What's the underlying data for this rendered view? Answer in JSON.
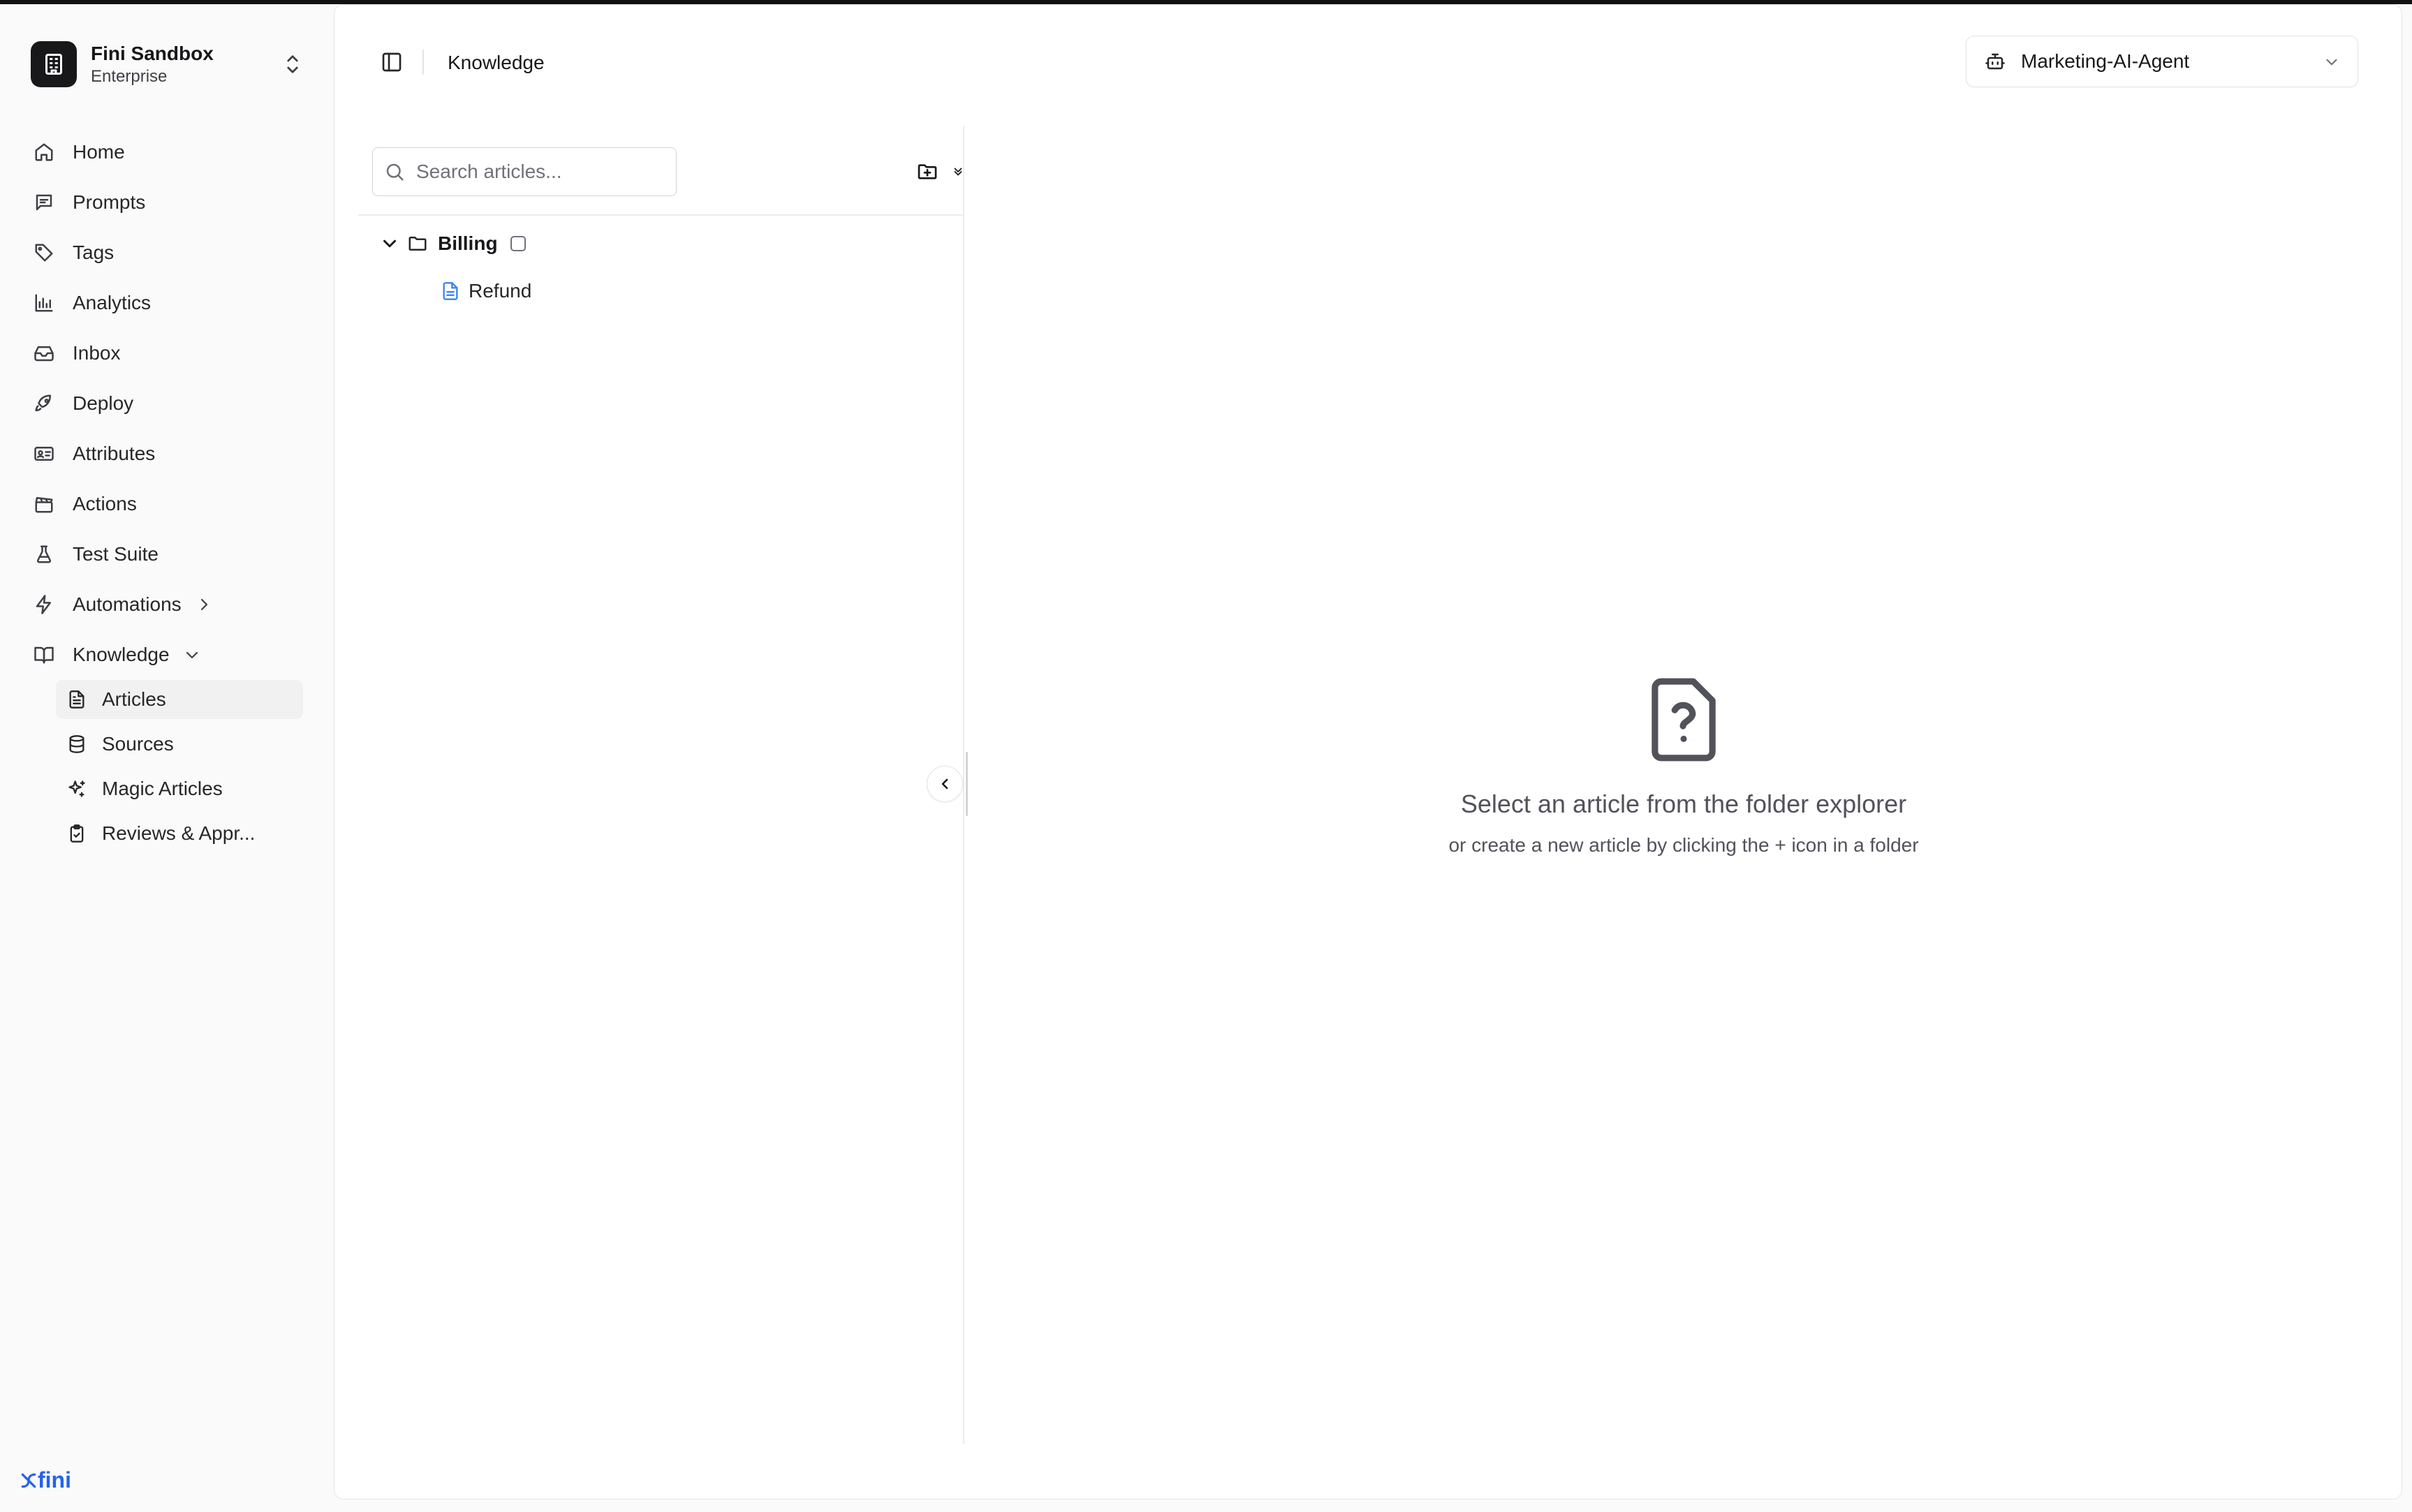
{
  "org": {
    "name": "Fini Sandbox",
    "plan": "Enterprise"
  },
  "nav": {
    "items": [
      {
        "label": "Home",
        "icon": "home-icon"
      },
      {
        "label": "Prompts",
        "icon": "message-square-icon"
      },
      {
        "label": "Tags",
        "icon": "tag-icon"
      },
      {
        "label": "Analytics",
        "icon": "bar-chart-icon"
      },
      {
        "label": "Inbox",
        "icon": "inbox-icon"
      },
      {
        "label": "Deploy",
        "icon": "rocket-icon"
      },
      {
        "label": "Attributes",
        "icon": "id-card-icon"
      },
      {
        "label": "Actions",
        "icon": "clapperboard-icon"
      },
      {
        "label": "Test Suite",
        "icon": "flask-icon"
      },
      {
        "label": "Automations",
        "icon": "zap-icon"
      },
      {
        "label": "Knowledge",
        "icon": "book-open-icon"
      }
    ],
    "knowledge_sub": [
      {
        "label": "Articles",
        "icon": "file-text-icon",
        "active": true
      },
      {
        "label": "Sources",
        "icon": "database-icon"
      },
      {
        "label": "Magic Articles",
        "icon": "sparkles-icon"
      },
      {
        "label": "Reviews & Appr...",
        "icon": "clipboard-check-icon"
      }
    ]
  },
  "brand": {
    "logo_text": "fini",
    "color": "#2563eb"
  },
  "header": {
    "title": "Knowledge",
    "agent": "Marketing-AI-Agent"
  },
  "explorer": {
    "search_placeholder": "Search articles...",
    "folders": [
      {
        "name": "Billing",
        "expanded": true,
        "articles": [
          "Refund"
        ]
      }
    ]
  },
  "empty_state": {
    "title": "Select an article from the folder explorer",
    "subtitle": "or create a new article by clicking the + icon in a folder",
    "icon": "file-question-icon"
  }
}
